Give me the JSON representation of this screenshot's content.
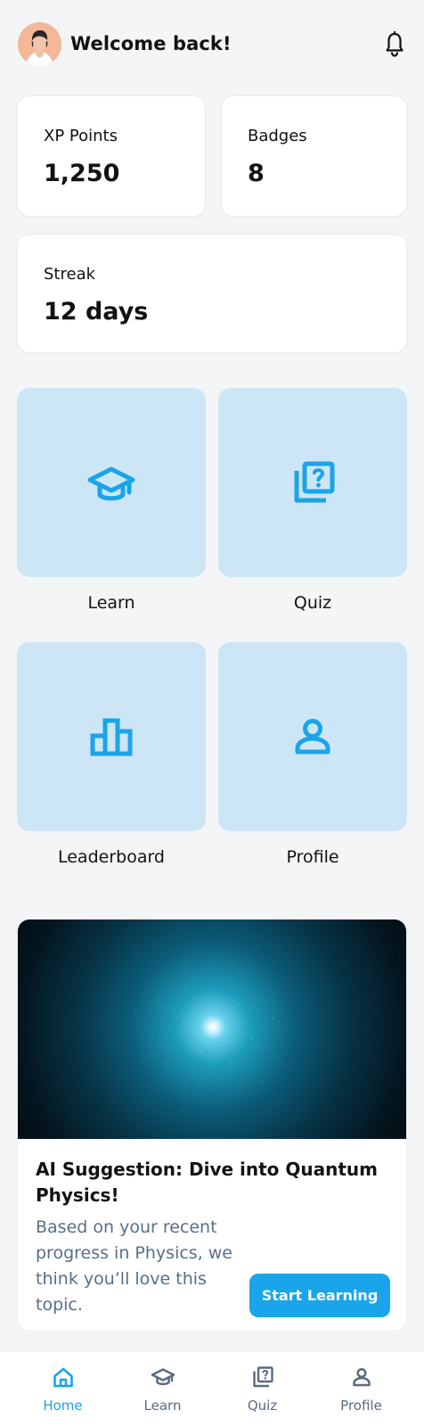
{
  "header": {
    "title": "Welcome back!",
    "avatar_icon": "user-avatar",
    "notification_icon": "bell-icon"
  },
  "stats": {
    "xp": {
      "label": "XP Points",
      "value": "1,250"
    },
    "badges": {
      "label": "Badges",
      "value": "8"
    },
    "streak": {
      "label": "Streak",
      "value": "12 days"
    }
  },
  "tiles": {
    "learn": {
      "label": "Learn",
      "icon": "graduation-cap-icon"
    },
    "quiz": {
      "label": "Quiz",
      "icon": "question-library-icon"
    },
    "leaderboard": {
      "label": "Leaderboard",
      "icon": "leaderboard-icon"
    },
    "profile": {
      "label": "Profile",
      "icon": "person-icon"
    }
  },
  "suggestion": {
    "title": "AI Suggestion: Dive into Quantum Physics!",
    "body": "Based on your recent progress in Physics, we think you’ll love this topic.",
    "button_label": "Start Learning"
  },
  "nav": {
    "items": [
      {
        "label": "Home",
        "icon": "home-icon",
        "active": true
      },
      {
        "label": "Learn",
        "icon": "graduation-cap-icon",
        "active": false
      },
      {
        "label": "Quiz",
        "icon": "quiz-icon",
        "active": false
      },
      {
        "label": "Profile",
        "icon": "person-icon",
        "active": false
      }
    ]
  },
  "colors": {
    "background": "#f4f5f7",
    "card": "#ffffff",
    "tile": "#cce6f6",
    "accent": "#1aa4ea",
    "text": "#121212",
    "muted": "#56708a"
  }
}
